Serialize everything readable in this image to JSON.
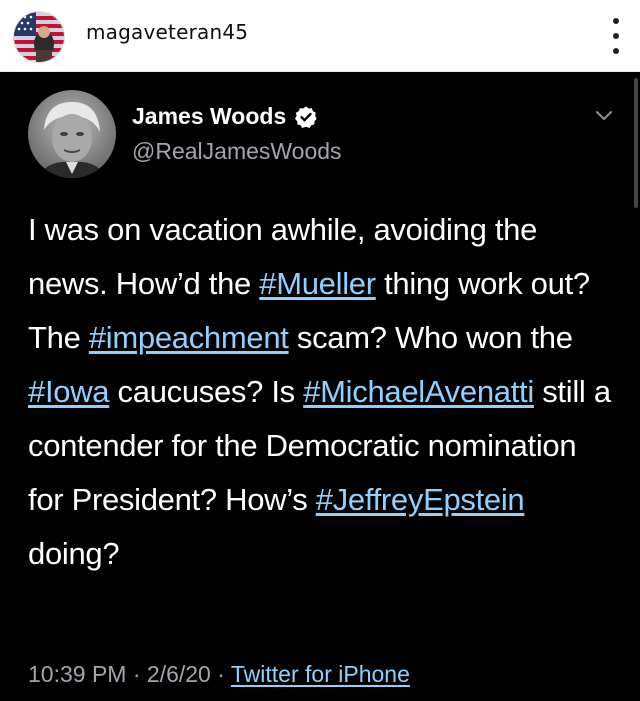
{
  "instagram": {
    "username": "magaveteran45"
  },
  "tweet": {
    "display_name": "James Woods",
    "handle": "@RealJamesWoods",
    "text_segments": [
      {
        "text": "I was on vacation awhile, avoiding the news. How’d the ",
        "hashtag": false
      },
      {
        "text": "#Mueller",
        "hashtag": true
      },
      {
        "text": " thing work out? The ",
        "hashtag": false
      },
      {
        "text": "#impeachment",
        "hashtag": true
      },
      {
        "text": " scam? Who won the ",
        "hashtag": false
      },
      {
        "text": "#Iowa",
        "hashtag": true
      },
      {
        "text": " caucuses? Is ",
        "hashtag": false
      },
      {
        "text": "#MichaelAvenatti",
        "hashtag": true
      },
      {
        "text": " still a contender for the Democratic nomination for President? How’s ",
        "hashtag": false
      },
      {
        "text": "#JeffreyEpstein",
        "hashtag": true
      },
      {
        "text": " doing?",
        "hashtag": false
      }
    ],
    "time": "10:39 PM",
    "date": "2/6/20",
    "separator": " · ",
    "source": "Twitter for iPhone"
  },
  "colors": {
    "background": "#000000",
    "link": "#8fd0ff",
    "muted": "#a0a6ad",
    "verified_badge": "#ffffff"
  },
  "icons": {
    "more": "more-vertical-icon",
    "verified": "verified-badge-icon",
    "caret": "chevron-down-icon"
  }
}
